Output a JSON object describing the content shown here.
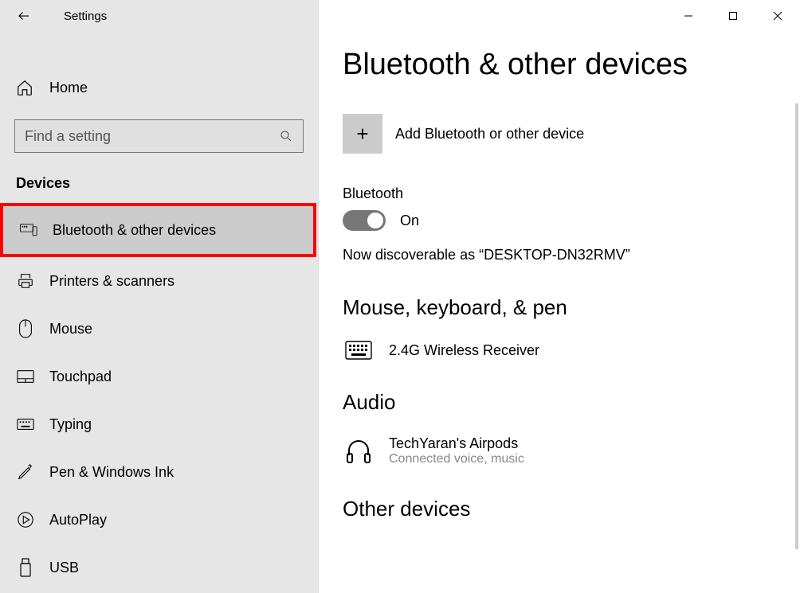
{
  "app_title": "Settings",
  "home_label": "Home",
  "search": {
    "placeholder": "Find a setting"
  },
  "category": "Devices",
  "nav": [
    {
      "key": "bluetooth",
      "label": "Bluetooth & other devices",
      "selected": true
    },
    {
      "key": "printers",
      "label": "Printers & scanners"
    },
    {
      "key": "mouse",
      "label": "Mouse"
    },
    {
      "key": "touchpad",
      "label": "Touchpad"
    },
    {
      "key": "typing",
      "label": "Typing"
    },
    {
      "key": "pen",
      "label": "Pen & Windows Ink"
    },
    {
      "key": "autoplay",
      "label": "AutoPlay"
    },
    {
      "key": "usb",
      "label": "USB"
    }
  ],
  "page": {
    "title": "Bluetooth & other devices",
    "add_label": "Add Bluetooth or other device",
    "bluetooth_label": "Bluetooth",
    "bluetooth_state": "On",
    "discoverable": "Now discoverable as “DESKTOP-DN32RMV”",
    "groups": {
      "mkp": {
        "title": "Mouse, keyboard, & pen",
        "devices": [
          {
            "name": "2.4G Wireless Receiver"
          }
        ]
      },
      "audio": {
        "title": "Audio",
        "devices": [
          {
            "name": "TechYaran's Airpods",
            "status": "Connected voice, music"
          }
        ]
      },
      "other": {
        "title": "Other devices"
      }
    }
  }
}
